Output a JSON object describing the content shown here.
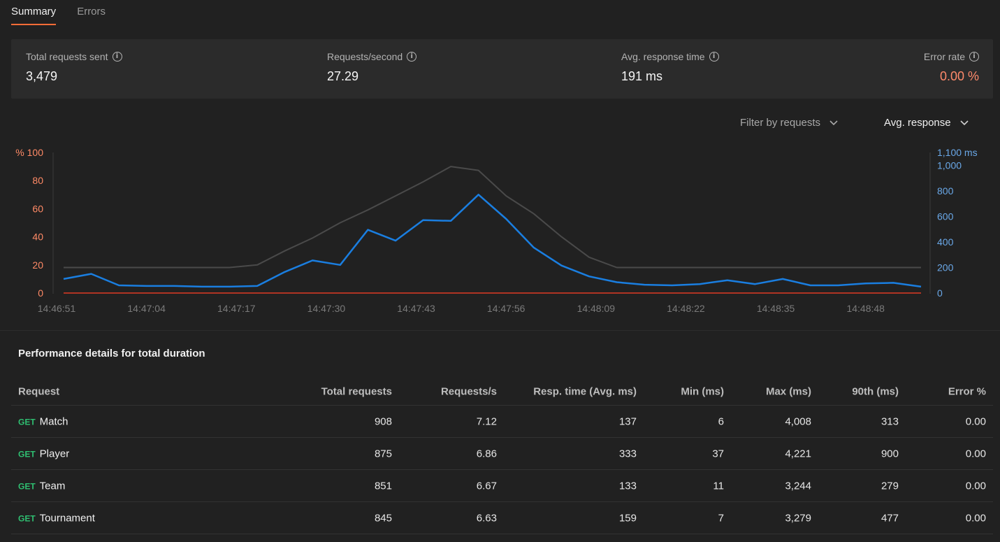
{
  "tabs": [
    {
      "label": "Summary",
      "active": true
    },
    {
      "label": "Errors",
      "active": false
    }
  ],
  "stats": {
    "total_requests": {
      "label": "Total requests sent",
      "value": "3,479"
    },
    "requests_per_second": {
      "label": "Requests/second",
      "value": "27.29"
    },
    "avg_response_time": {
      "label": "Avg. response time",
      "value": "191 ms"
    },
    "error_rate": {
      "label": "Error rate",
      "value": "0.00 %",
      "color": "#ff8a6b"
    }
  },
  "filters": {
    "filter_by": "Filter by requests",
    "metric": "Avg. response"
  },
  "chart_data": {
    "type": "line",
    "x": [
      "14:46:51",
      "14:46:55",
      "14:46:59",
      "14:47:03",
      "14:47:07",
      "14:47:11",
      "14:47:15",
      "14:47:19",
      "14:47:23",
      "14:47:27",
      "14:47:31",
      "14:47:35",
      "14:47:39",
      "14:47:43",
      "14:47:47",
      "14:47:51",
      "14:47:55",
      "14:47:59",
      "14:48:03",
      "14:48:07",
      "14:48:11",
      "14:48:15",
      "14:48:19",
      "14:48:23",
      "14:48:27",
      "14:48:31",
      "14:48:35",
      "14:48:39",
      "14:48:43",
      "14:48:47",
      "14:48:51",
      "14:48:55"
    ],
    "x_tick_labels": [
      "14:46:51",
      "14:47:04",
      "14:47:17",
      "14:47:30",
      "14:47:43",
      "14:47:56",
      "14:48:09",
      "14:48:22",
      "14:48:35",
      "14:48:48"
    ],
    "left_axis": {
      "ticks": [
        "% 100",
        "80",
        "60",
        "40",
        "20",
        "0"
      ],
      "ylim": [
        0,
        100
      ],
      "color": "#ff8a66"
    },
    "right_axis": {
      "ticks": [
        "1,100 ms",
        "1,000",
        "800",
        "600",
        "400",
        "200",
        "0"
      ],
      "ylim": [
        0,
        1100
      ],
      "color": "#6aa8e8"
    },
    "series": [
      {
        "color": "#4a4a4a",
        "axis": "right",
        "values": [
          200,
          200,
          200,
          200,
          200,
          200,
          200,
          220,
          330,
          430,
          550,
          650,
          760,
          870,
          990,
          960,
          760,
          620,
          440,
          280,
          200,
          200,
          200,
          200,
          200,
          200,
          200,
          200,
          200,
          200,
          200,
          200
        ]
      },
      {
        "color": "#1a7ee0",
        "axis": "right",
        "values": [
          110,
          150,
          60,
          55,
          55,
          50,
          50,
          55,
          165,
          255,
          220,
          495,
          410,
          570,
          565,
          770,
          580,
          355,
          215,
          130,
          85,
          65,
          60,
          70,
          100,
          70,
          110,
          60,
          60,
          75,
          80,
          50
        ]
      },
      {
        "color": "#e03b24",
        "axis": "left",
        "values": [
          0,
          0,
          0,
          0,
          0,
          0,
          0,
          0,
          0,
          0,
          0,
          0,
          0,
          0,
          0,
          0,
          0,
          0,
          0,
          0,
          0,
          0,
          0,
          0,
          0,
          0,
          0,
          0,
          0,
          0,
          0,
          0
        ]
      }
    ]
  },
  "performance": {
    "title": "Performance details for total duration",
    "headers": [
      "Request",
      "Total requests",
      "Requests/s",
      "Resp. time (Avg. ms)",
      "Min (ms)",
      "Max (ms)",
      "90th (ms)",
      "Error %"
    ],
    "rows": [
      {
        "method": "GET",
        "name": "Match",
        "total": "908",
        "rps": "7.12",
        "avg": "137",
        "min": "6",
        "max": "4,008",
        "p90": "313",
        "err": "0.00"
      },
      {
        "method": "GET",
        "name": "Player",
        "total": "875",
        "rps": "6.86",
        "avg": "333",
        "min": "37",
        "max": "4,221",
        "p90": "900",
        "err": "0.00"
      },
      {
        "method": "GET",
        "name": "Team",
        "total": "851",
        "rps": "6.67",
        "avg": "133",
        "min": "11",
        "max": "3,244",
        "p90": "279",
        "err": "0.00"
      },
      {
        "method": "GET",
        "name": "Tournament",
        "total": "845",
        "rps": "6.63",
        "avg": "159",
        "min": "7",
        "max": "3,279",
        "p90": "477",
        "err": "0.00"
      }
    ]
  }
}
